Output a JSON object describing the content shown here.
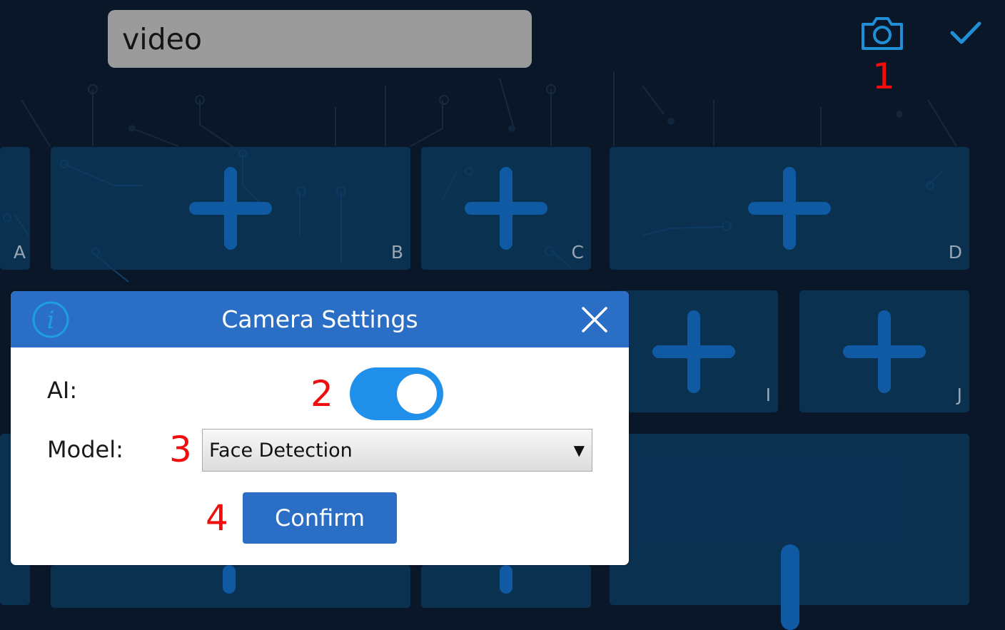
{
  "header": {
    "title_value": "video",
    "camera_icon": "camera-icon",
    "check_icon": "check-icon"
  },
  "tiles": [
    {
      "label": "A"
    },
    {
      "label": "B"
    },
    {
      "label": "C"
    },
    {
      "label": "D"
    },
    {
      "label": "I"
    },
    {
      "label": "J"
    },
    {
      "label": ""
    },
    {
      "label": ""
    },
    {
      "label": ""
    },
    {
      "label": ""
    }
  ],
  "dialog": {
    "title": "Camera Settings",
    "info_icon": "info-icon",
    "close_icon": "close-icon",
    "ai_label": "AI:",
    "ai_enabled": true,
    "model_label": "Model:",
    "model_value": "Face Detection",
    "confirm_label": "Confirm"
  },
  "annotations": {
    "n1": "1",
    "n2": "2",
    "n3": "3",
    "n4": "4"
  },
  "colors": {
    "background": "#0a1728",
    "tile": "#0c385e",
    "plus": "#0f5aa3",
    "dialog_header": "#2a6ec6",
    "toggle_on": "#2190ea",
    "annotation": "#f00d0d",
    "icon_blue": "#1f8fd6"
  }
}
